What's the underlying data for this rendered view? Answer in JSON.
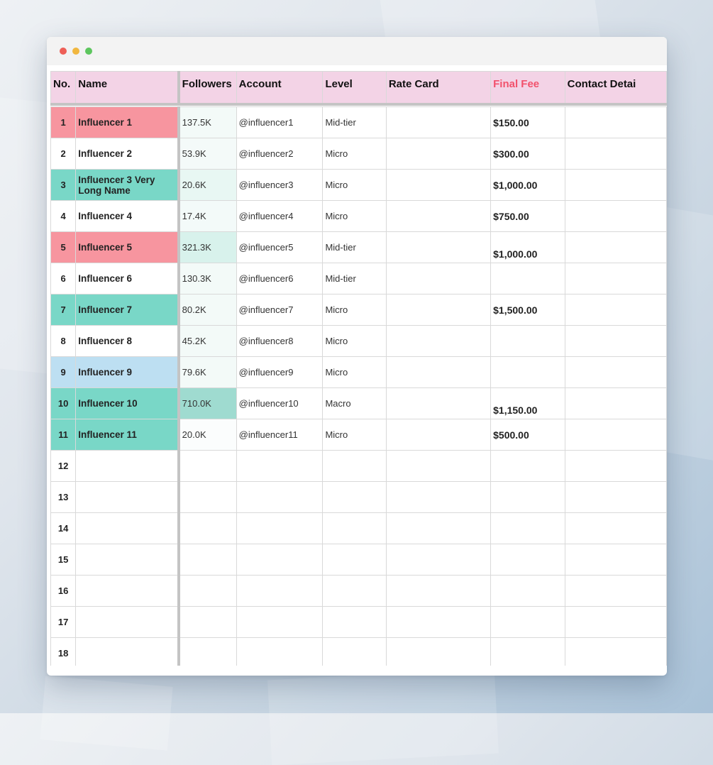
{
  "headers": {
    "no": "No.",
    "name": "Name",
    "followers": "Followers",
    "account": "Account",
    "level": "Level",
    "rate_card": "Rate Card",
    "final_fee": "Final Fee",
    "contact": "Contact Detai"
  },
  "rows": [
    {
      "no": "1",
      "name": "Influencer 1",
      "followers": "137.5K",
      "account": "@influencer1",
      "level": "Mid-tier",
      "rate_card": "",
      "fee": "$150.00",
      "contact": ""
    },
    {
      "no": "2",
      "name": "Influencer 2",
      "followers": "53.9K",
      "account": "@influencer2",
      "level": "Micro",
      "rate_card": "",
      "fee": "$300.00",
      "contact": ""
    },
    {
      "no": "3",
      "name": "Influencer 3 Very Long Name",
      "followers": "20.6K",
      "account": "@influencer3",
      "level": "Micro",
      "rate_card": "",
      "fee": "$1,000.00",
      "contact": ""
    },
    {
      "no": "4",
      "name": "Influencer 4",
      "followers": "17.4K",
      "account": "@influencer4",
      "level": "Micro",
      "rate_card": "",
      "fee": "$750.00",
      "contact": ""
    },
    {
      "no": "5",
      "name": "Influencer 5",
      "followers": "321.3K",
      "account": "@influencer5",
      "level": "Mid-tier",
      "rate_card": "",
      "fee": "$1,000.00",
      "contact": ""
    },
    {
      "no": "6",
      "name": "Influencer 6",
      "followers": "130.3K",
      "account": "@influencer6",
      "level": "Mid-tier",
      "rate_card": "",
      "fee": "",
      "contact": ""
    },
    {
      "no": "7",
      "name": "Influencer 7",
      "followers": "80.2K",
      "account": "@influencer7",
      "level": "Micro",
      "rate_card": "",
      "fee": "$1,500.00",
      "contact": ""
    },
    {
      "no": "8",
      "name": "Influencer 8",
      "followers": "45.2K",
      "account": "@influencer8",
      "level": "Micro",
      "rate_card": "",
      "fee": "",
      "contact": ""
    },
    {
      "no": "9",
      "name": "Influencer 9",
      "followers": "79.6K",
      "account": "@influencer9",
      "level": "Micro",
      "rate_card": "",
      "fee": "",
      "contact": ""
    },
    {
      "no": "10",
      "name": "Influencer 10",
      "followers": "710.0K",
      "account": "@influencer10",
      "level": "Macro",
      "rate_card": "",
      "fee": "$1,150.00",
      "contact": ""
    },
    {
      "no": "11",
      "name": "Influencer 11",
      "followers": "20.0K",
      "account": "@influencer11",
      "level": "Micro",
      "rate_card": "",
      "fee": "$500.00",
      "contact": ""
    },
    {
      "no": "12",
      "name": "",
      "followers": "",
      "account": "",
      "level": "",
      "rate_card": "",
      "fee": "",
      "contact": ""
    },
    {
      "no": "13",
      "name": "",
      "followers": "",
      "account": "",
      "level": "",
      "rate_card": "",
      "fee": "",
      "contact": ""
    },
    {
      "no": "14",
      "name": "",
      "followers": "",
      "account": "",
      "level": "",
      "rate_card": "",
      "fee": "",
      "contact": ""
    },
    {
      "no": "15",
      "name": "",
      "followers": "",
      "account": "",
      "level": "",
      "rate_card": "",
      "fee": "",
      "contact": ""
    },
    {
      "no": "16",
      "name": "",
      "followers": "",
      "account": "",
      "level": "",
      "rate_card": "",
      "fee": "",
      "contact": ""
    },
    {
      "no": "17",
      "name": "",
      "followers": "",
      "account": "",
      "level": "",
      "rate_card": "",
      "fee": "",
      "contact": ""
    },
    {
      "no": "18",
      "name": "",
      "followers": "",
      "account": "",
      "level": "",
      "rate_card": "",
      "fee": "",
      "contact": ""
    }
  ],
  "colors": {
    "header_bg": "#f3d3e6",
    "final_fee_header": "#f2516c",
    "row_pink": "#f7959f",
    "row_teal": "#79d7c7",
    "row_blue": "#bddff2",
    "followers_heat": [
      "#f3faf8",
      "#f4faf9",
      "#e8f7f3",
      "#f3faf9",
      "#d8f2ec",
      "#f3faf8",
      "#f3faf8",
      "#f3faf8",
      "#f3faf8",
      "#9fdbd0",
      "#fbfdfd"
    ]
  },
  "row_colors": [
    "pink",
    "none",
    "teal",
    "none",
    "pink",
    "none",
    "teal",
    "none",
    "blue",
    "teal",
    "teal"
  ]
}
